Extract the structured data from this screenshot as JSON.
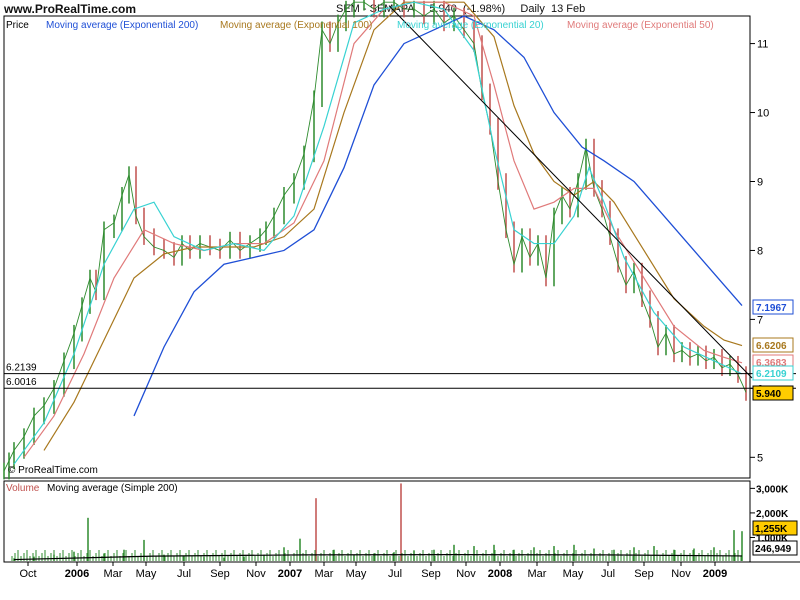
{
  "header": {
    "site": "www.ProRealTime.com",
    "title": "SEM - SEMAPA     5.940  (-1.98%)     Daily  13 Feb"
  },
  "watermark": "© ProRealTime.com",
  "colors": {
    "price_up": "#2e8b2e",
    "price_down": "#c0504d",
    "ema200": "#1f4fd6",
    "ema100": "#a8781e",
    "ema50": "#e07a7a",
    "ema20": "#38d2d2",
    "trendline": "#000000",
    "volume": "#2e8b2e",
    "volume_ma": "#000000"
  },
  "chart_data": [
    {
      "type": "line",
      "panel": "price",
      "legend": [
        "Price",
        "Moving average (Exponential 200)",
        "Moving average (Exponential 100)",
        "Moving average (Exponential 20)",
        "Moving average (Exponential 50)"
      ],
      "x_ticks": [
        "Oct",
        "2006",
        "Mar",
        "May",
        "Jul",
        "Sep",
        "Nov",
        "2007",
        "Mar",
        "May",
        "Jul",
        "Sep",
        "Nov",
        "2008",
        "Mar",
        "May",
        "Jul",
        "Sep",
        "Nov",
        "2009"
      ],
      "y_ticks": [
        5,
        6,
        7,
        8,
        9,
        10,
        11
      ],
      "ylim": [
        4.7,
        11.4
      ],
      "price_x": [
        0,
        5,
        10,
        20,
        30,
        40,
        50,
        60,
        70,
        78,
        86,
        92,
        100,
        110,
        118,
        125,
        132,
        140,
        150,
        160,
        170,
        178,
        186,
        196,
        206,
        216,
        226,
        236,
        246,
        256,
        262,
        270,
        280,
        290,
        300,
        310,
        318,
        326,
        334,
        342,
        350,
        360,
        370,
        380,
        390,
        400,
        410,
        420,
        430,
        440,
        450,
        460,
        470,
        478,
        486,
        494,
        502,
        510,
        518,
        526,
        534,
        542,
        550,
        558,
        566,
        574,
        582,
        590,
        598,
        606,
        614,
        622,
        630,
        638,
        646,
        654,
        662,
        670,
        678,
        686,
        694,
        702,
        710,
        718,
        726,
        734,
        742
      ],
      "price_y": [
        4.8,
        4.95,
        5.1,
        5.3,
        5.6,
        5.75,
        6.0,
        6.4,
        6.8,
        7.2,
        7.6,
        7.4,
        8.3,
        8.4,
        8.8,
        9.1,
        8.5,
        8.2,
        8.05,
        8.0,
        7.9,
        8.1,
        8.0,
        8.1,
        8.05,
        8.0,
        8.15,
        8.0,
        8.1,
        8.2,
        8.3,
        8.5,
        8.8,
        9.0,
        9.4,
        10.2,
        11.2,
        11.0,
        11.3,
        11.5,
        11.6,
        11.6,
        11.5,
        11.6,
        11.6,
        11.5,
        11.5,
        11.4,
        11.5,
        11.3,
        11.4,
        11.2,
        11.0,
        10.3,
        9.8,
        9.0,
        8.3,
        7.8,
        8.2,
        7.9,
        8.1,
        7.6,
        8.5,
        8.8,
        8.6,
        9.0,
        9.5,
        8.9,
        8.6,
        8.2,
        7.8,
        7.5,
        7.7,
        7.3,
        7.0,
        6.6,
        6.8,
        6.5,
        6.55,
        6.45,
        6.5,
        6.4,
        6.45,
        6.3,
        6.35,
        6.2,
        5.94
      ],
      "ema200_x": [
        130,
        160,
        190,
        220,
        250,
        280,
        310,
        340,
        370,
        400,
        430,
        460,
        490,
        520,
        550,
        578,
        600,
        630,
        660,
        690,
        720,
        738
      ],
      "ema200_y": [
        5.6,
        6.6,
        7.4,
        7.8,
        7.9,
        8.0,
        8.3,
        9.2,
        10.4,
        11.0,
        11.2,
        11.4,
        11.2,
        10.8,
        10.0,
        9.5,
        9.3,
        9.0,
        8.5,
        8.0,
        7.5,
        7.2
      ],
      "ema100_x": [
        40,
        70,
        100,
        130,
        160,
        190,
        220,
        250,
        280,
        310,
        340,
        370,
        400,
        430,
        460,
        490,
        510,
        530,
        550,
        570,
        590,
        610,
        640,
        670,
        700,
        720,
        738
      ],
      "ema100_y": [
        5.1,
        5.8,
        6.7,
        7.6,
        7.95,
        8.05,
        8.05,
        8.05,
        8.2,
        8.6,
        10.0,
        11.2,
        11.6,
        11.6,
        11.6,
        11.1,
        10.1,
        9.4,
        9.0,
        8.8,
        9.0,
        8.7,
        8.0,
        7.3,
        6.9,
        6.7,
        6.62
      ],
      "ema50_x": [
        20,
        50,
        80,
        110,
        140,
        170,
        200,
        230,
        260,
        290,
        320,
        350,
        380,
        410,
        440,
        470,
        490,
        510,
        530,
        550,
        570,
        590,
        610,
        640,
        670,
        700,
        720,
        738
      ],
      "ema50_y": [
        5.0,
        5.6,
        6.5,
        7.6,
        8.3,
        8.1,
        8.0,
        8.1,
        8.1,
        8.4,
        9.3,
        11.0,
        11.5,
        11.6,
        11.6,
        11.4,
        10.4,
        9.3,
        8.6,
        8.7,
        8.9,
        8.9,
        8.3,
        7.6,
        6.9,
        6.55,
        6.45,
        6.37
      ],
      "ema20_x": [
        10,
        40,
        70,
        100,
        130,
        150,
        170,
        200,
        230,
        260,
        290,
        320,
        350,
        380,
        410,
        440,
        470,
        490,
        510,
        530,
        550,
        570,
        585,
        600,
        620,
        650,
        680,
        710,
        738
      ],
      "ema20_y": [
        4.9,
        5.5,
        6.5,
        7.8,
        8.6,
        8.7,
        8.2,
        8.0,
        8.1,
        8.0,
        8.5,
        9.8,
        11.3,
        11.5,
        11.6,
        11.5,
        10.9,
        9.5,
        8.3,
        8.1,
        8.1,
        8.5,
        9.2,
        8.7,
        7.9,
        7.1,
        6.6,
        6.4,
        6.21
      ],
      "trendline": {
        "x": [
          385,
          748
        ],
        "y": [
          11.55,
          6.15
        ]
      },
      "hlines": [
        {
          "label": "6.2139",
          "value": 6.2139
        },
        {
          "label": "6.0016",
          "value": 6.0016
        }
      ],
      "tags": [
        {
          "label": "7.1967",
          "value": 7.1967,
          "color": "#1f4fd6"
        },
        {
          "label": "6.6206",
          "value": 6.6206,
          "color": "#a8781e"
        },
        {
          "label": "6.3683",
          "value": 6.3683,
          "color": "#e07a7a"
        },
        {
          "label": "6.2109",
          "value": 6.2109,
          "color": "#38d2d2"
        },
        {
          "label": "5.940",
          "value": 5.94,
          "color": "#000000"
        }
      ]
    },
    {
      "type": "bar",
      "panel": "volume",
      "legend": [
        "Volume",
        "Moving average (Simple 200)"
      ],
      "y_ticks": [
        "3,000K",
        "2,000K",
        "1,000K"
      ],
      "ylim": [
        0,
        3300
      ],
      "vol_x": [
        10,
        30,
        50,
        70,
        84,
        100,
        120,
        140,
        160,
        180,
        200,
        220,
        240,
        260,
        280,
        296,
        312,
        330,
        350,
        370,
        390,
        397,
        410,
        430,
        450,
        470,
        490,
        510,
        530,
        550,
        570,
        590,
        610,
        630,
        650,
        670,
        690,
        710,
        730,
        738
      ],
      "vol_values": [
        150,
        220,
        300,
        420,
        1800,
        350,
        500,
        900,
        300,
        250,
        200,
        180,
        220,
        300,
        600,
        950,
        2600,
        500,
        300,
        350,
        400,
        3200,
        450,
        500,
        700,
        650,
        700,
        500,
        600,
        650,
        700,
        550,
        500,
        600,
        650,
        500,
        550,
        600,
        1300,
        1255
      ],
      "ma_x": [
        10,
        150,
        300,
        450,
        600,
        738
      ],
      "ma_y": [
        100,
        240,
        290,
        300,
        290,
        247
      ],
      "tags": [
        {
          "label": "1,255K",
          "value": 1255
        },
        {
          "label": "246,949",
          "value": 247
        }
      ]
    }
  ]
}
